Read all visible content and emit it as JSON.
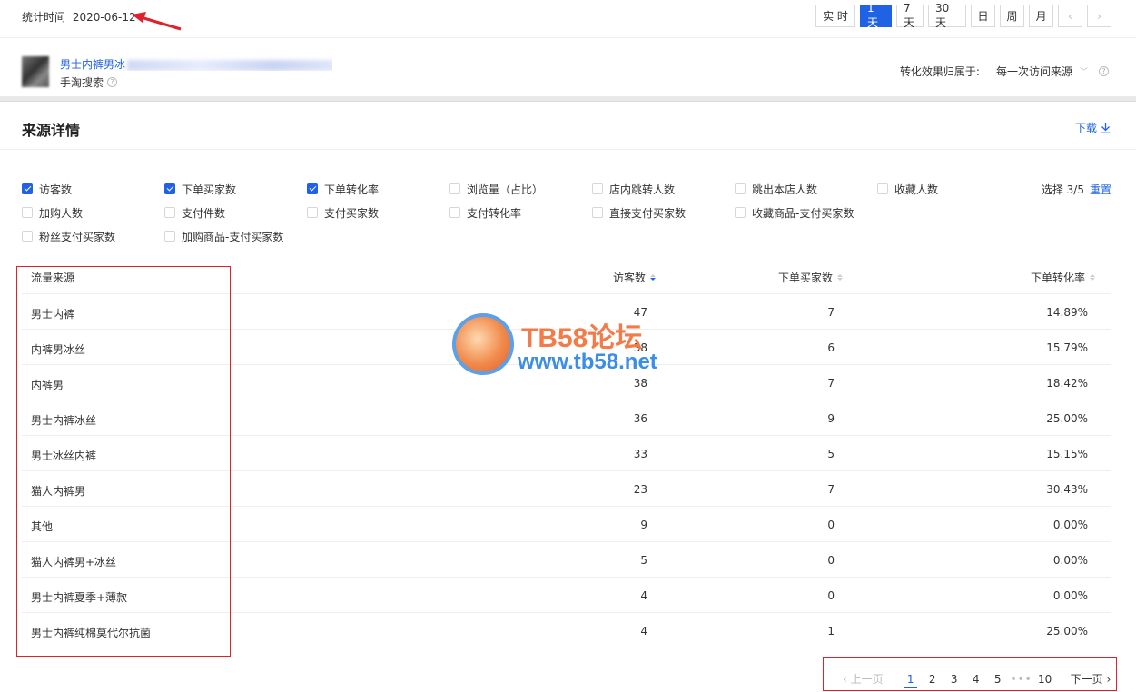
{
  "header": {
    "stat_label": "统计时间",
    "stat_date": "2020-06-12",
    "periods": [
      {
        "label": "实 时",
        "active": false
      },
      {
        "label": "1天",
        "active": true
      },
      {
        "label": "7天",
        "active": false
      },
      {
        "label": "30天",
        "active": false
      },
      {
        "label": "日",
        "active": false
      },
      {
        "label": "周",
        "active": false
      },
      {
        "label": "月",
        "active": false
      }
    ],
    "prev_arrow": "‹",
    "next_arrow": "›"
  },
  "product": {
    "title": "男士内裤男冰",
    "source": "手淘搜索",
    "help_icon": "question-icon",
    "attribution_label": "转化效果归属于:",
    "attribution_value": "每一次访问来源"
  },
  "section": {
    "title": "来源详情",
    "download_label": "下载"
  },
  "metrics": {
    "rows": [
      [
        {
          "label": "访客数",
          "checked": true
        },
        {
          "label": "下单买家数",
          "checked": true
        },
        {
          "label": "下单转化率",
          "checked": true
        },
        {
          "label": "浏览量（占比）",
          "checked": false
        },
        {
          "label": "店内跳转人数",
          "checked": false
        },
        {
          "label": "跳出本店人数",
          "checked": false
        },
        {
          "label": "收藏人数",
          "checked": false
        }
      ],
      [
        {
          "label": "加购人数",
          "checked": false
        },
        {
          "label": "支付件数",
          "checked": false
        },
        {
          "label": "支付买家数",
          "checked": false
        },
        {
          "label": "支付转化率",
          "checked": false
        },
        {
          "label": "直接支付买家数",
          "checked": false
        },
        {
          "label": "收藏商品-支付买家数",
          "checked": false
        }
      ],
      [
        {
          "label": "粉丝支付买家数",
          "checked": false
        },
        {
          "label": "加购商品-支付买家数",
          "checked": false
        }
      ]
    ],
    "select_count": "选择 3/5",
    "reset_label": "重置"
  },
  "table": {
    "columns": [
      "流量来源",
      "访客数",
      "下单买家数",
      "下单转化率"
    ],
    "rows": [
      [
        "男士内裤",
        "47",
        "7",
        "14.89%"
      ],
      [
        "内裤男冰丝",
        "38",
        "6",
        "15.79%"
      ],
      [
        "内裤男",
        "38",
        "7",
        "18.42%"
      ],
      [
        "男士内裤冰丝",
        "36",
        "9",
        "25.00%"
      ],
      [
        "男士冰丝内裤",
        "33",
        "5",
        "15.15%"
      ],
      [
        "猫人内裤男",
        "23",
        "7",
        "30.43%"
      ],
      [
        "其他",
        "9",
        "0",
        "0.00%"
      ],
      [
        "猫人内裤男+冰丝",
        "5",
        "0",
        "0.00%"
      ],
      [
        "男士内裤夏季+薄款",
        "4",
        "0",
        "0.00%"
      ],
      [
        "男士内裤纯棉莫代尔抗菌",
        "4",
        "1",
        "25.00%"
      ]
    ]
  },
  "pagination": {
    "prev_label": "上一页",
    "pages": [
      "1",
      "2",
      "3",
      "4",
      "5"
    ],
    "current": "1",
    "ellipsis": "•••",
    "last_page": "10",
    "next_label": "下一页"
  },
  "watermark": {
    "name": "TB58论坛",
    "url": "www.tb58.net"
  }
}
